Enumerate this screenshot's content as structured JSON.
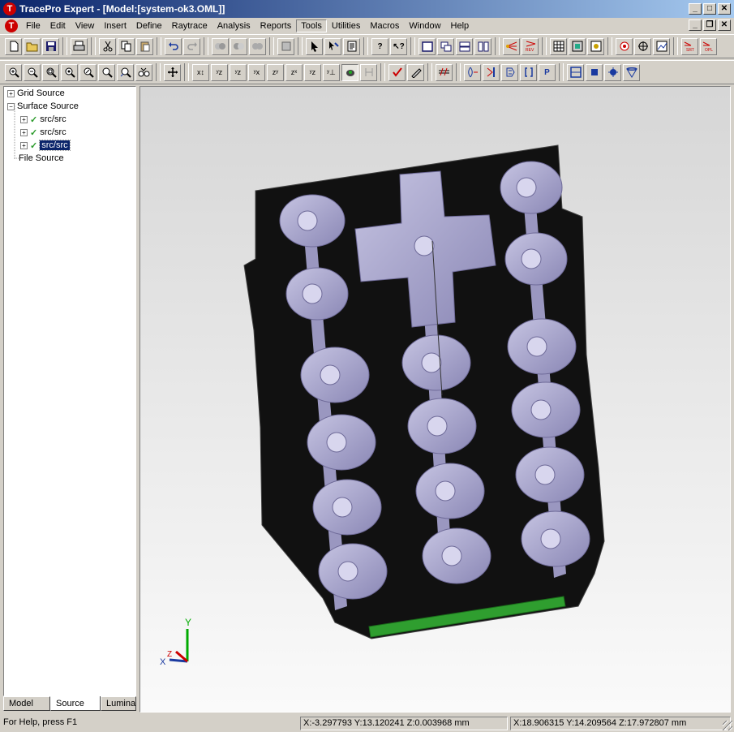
{
  "window": {
    "title": "TracePro Expert - [Model:[system-ok3.OML]]",
    "app_icon_glyph": "T"
  },
  "menu": {
    "items": [
      "File",
      "Edit",
      "View",
      "Insert",
      "Define",
      "Raytrace",
      "Analysis",
      "Reports",
      "Tools",
      "Utilities",
      "Macros",
      "Window",
      "Help"
    ],
    "active": "Tools"
  },
  "toolbar1": {
    "icons": [
      "new-file-icon",
      "open-folder-icon",
      "save-icon",
      "print-icon",
      "cut-icon",
      "copy-icon",
      "paste-icon",
      "undo-icon",
      "redo-icon",
      "boolean-intersect-icon",
      "boolean-subtract-icon",
      "boolean-union-icon",
      "move-object-icon",
      "select-arrow-icon",
      "select-edge-icon",
      "properties-sheet-icon",
      "help-icon",
      "context-help-icon",
      "view-single-icon",
      "view-cascade-icon",
      "view-horizontal-icon",
      "view-vertical-icon",
      "raytrace-icon",
      "rev-raytrace-icon",
      "grid-icon",
      "irradiance-map-icon",
      "candela-plot-icon",
      "source-icon",
      "target-icon",
      "ray-sort-icon",
      "srt-icon",
      "opl-icon"
    ]
  },
  "toolbar2": {
    "icons": [
      "zoom-in-icon",
      "zoom-out-icon",
      "zoom-window-icon",
      "zoom-all-icon",
      "zoom-selection-icon",
      "zoom-dynamic-icon",
      "zoom-previous-icon",
      "pan-icon",
      "rotate-xy-icon",
      "rotate-yz-icon",
      "rotate-xz-icon",
      "rotate-x-icon",
      "rotate-z-icon",
      "rotate-free-icon",
      "view-iso-icon",
      "view-axes-icon",
      "view-silhouette-icon",
      "hidden-line-icon",
      "checkmark-icon",
      "pen-icon",
      "ray-display-icon",
      "lens-icon",
      "filter-icon",
      "mirror-icon",
      "bracket-icon",
      "p-icon",
      "grid-box-icon",
      "dot-square-icon",
      "splash-icon",
      "cone-icon"
    ],
    "active_icon": "view-silhouette-icon"
  },
  "tree": {
    "items": [
      {
        "label": "Grid Source",
        "expander": "+",
        "level": 0,
        "check": false
      },
      {
        "label": "Surface Source",
        "expander": "−",
        "level": 0,
        "check": false
      },
      {
        "label": "src/src",
        "expander": "+",
        "level": 1,
        "check": true
      },
      {
        "label": "src/src",
        "expander": "+",
        "level": 1,
        "check": true
      },
      {
        "label": "src/src",
        "expander": "+",
        "level": 1,
        "check": true,
        "selected": true
      },
      {
        "label": "File Source",
        "expander": "",
        "level": 0,
        "check": false
      }
    ]
  },
  "tabs": {
    "items": [
      "Model",
      "Source",
      "Lumina"
    ],
    "active": "Source"
  },
  "axis": {
    "y_label": "Y",
    "x_label": "X",
    "z_label": "Z"
  },
  "status": {
    "help": "For Help, press F1",
    "coords1": "X:-3.297793 Y:13.120241 Z:0.003968 mm",
    "coords2": "X:18.906315 Y:14.209564 Z:17.972807 mm"
  },
  "colors": {
    "titlebar_start": "#0a246a",
    "key_fill": "#a4a1c9",
    "frame": "#0e0e0e",
    "green_board": "#2f9e2f",
    "selection": "#0a246a"
  }
}
